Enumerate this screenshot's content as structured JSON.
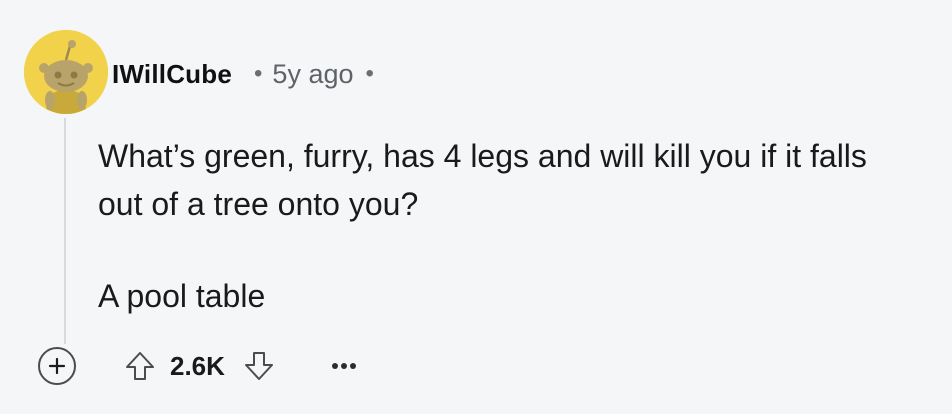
{
  "comment": {
    "username": "IWillCube",
    "timestamp": "5y ago",
    "separator": "•",
    "body": {
      "question": "What’s green, furry, has 4 legs and will kill you if it falls out of a tree onto you?",
      "answer": "A pool table"
    },
    "score": "2.6K",
    "avatar_color": "#f2d24b",
    "icons": {
      "expand": "plus-circle-icon",
      "upvote": "upvote-arrow-icon",
      "downvote": "downvote-arrow-icon",
      "more": "more-options-icon"
    }
  }
}
